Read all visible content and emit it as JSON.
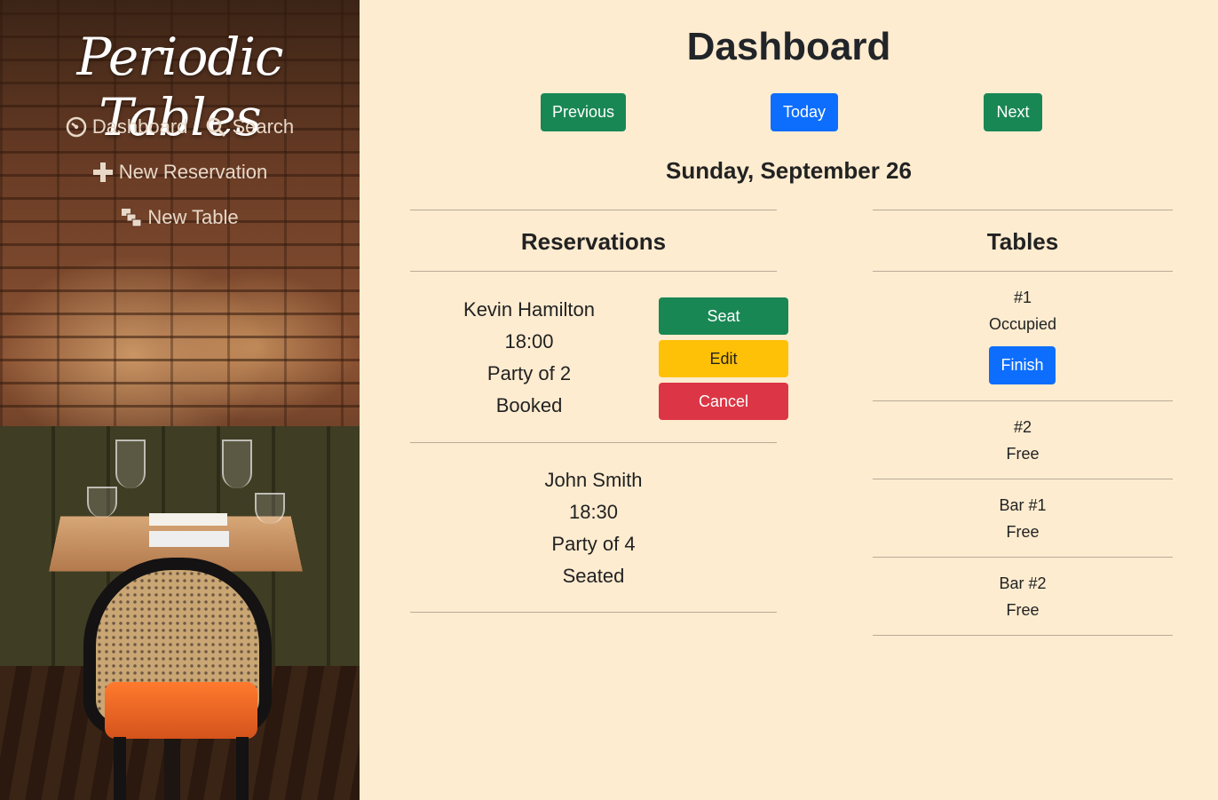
{
  "sidebar": {
    "brand": "Periodic Tables",
    "nav": {
      "dashboard": "Dashboard",
      "search": "Search",
      "new_reservation": "New Reservation",
      "new_table": "New Table"
    }
  },
  "main": {
    "title": "Dashboard",
    "buttons": {
      "previous": "Previous",
      "today": "Today",
      "next": "Next"
    },
    "date": "Sunday, September 26"
  },
  "reservations": {
    "heading": "Reservations",
    "items": [
      {
        "name": "Kevin Hamilton",
        "time": "18:00",
        "party": "Party of 2",
        "status": "Booked",
        "actions": {
          "seat": "Seat",
          "edit": "Edit",
          "cancel": "Cancel"
        }
      },
      {
        "name": "John Smith",
        "time": "18:30",
        "party": "Party of 4",
        "status": "Seated"
      }
    ]
  },
  "tables": {
    "heading": "Tables",
    "items": [
      {
        "name": "#1",
        "status": "Occupied",
        "finish": "Finish"
      },
      {
        "name": "#2",
        "status": "Free"
      },
      {
        "name": "Bar #1",
        "status": "Free"
      },
      {
        "name": "Bar #2",
        "status": "Free"
      }
    ]
  },
  "colors": {
    "background": "#feecd0",
    "green": "#198754",
    "blue": "#0d6efd",
    "yellow": "#ffc107",
    "red": "#dc3545"
  }
}
